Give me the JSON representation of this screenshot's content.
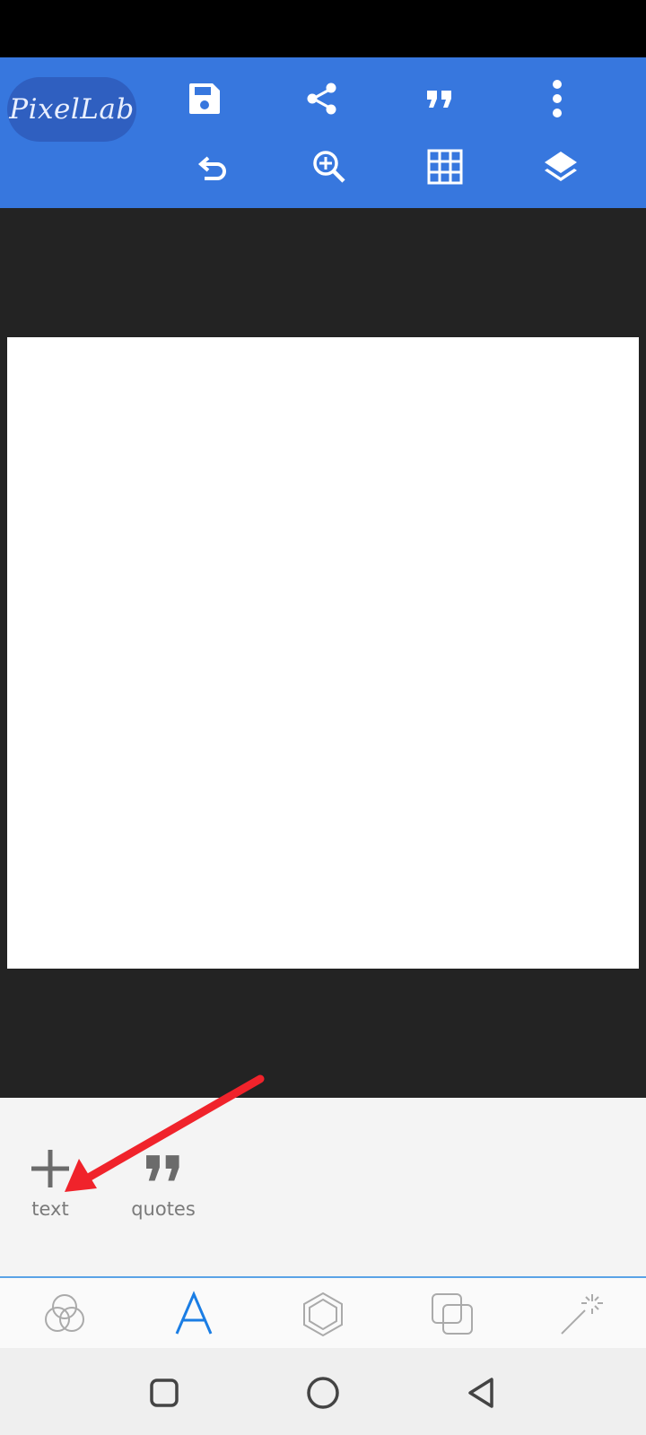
{
  "app": {
    "logo_text": "PixelLab"
  },
  "toolbar": {
    "row1": [
      "plus-icon",
      "save-icon",
      "share-icon",
      "quote-icon",
      "more-vert-icon"
    ],
    "row2": [
      "undo-icon",
      "zoom-in-icon",
      "grid-icon",
      "layers-icon"
    ]
  },
  "panel": {
    "items": [
      {
        "label": "text",
        "icon": "plus-icon"
      },
      {
        "label": "quotes",
        "icon": "quote-icon"
      }
    ]
  },
  "tabs": [
    {
      "name": "color-blend",
      "icon": "circles-icon",
      "active": false
    },
    {
      "name": "text",
      "icon": "letter-a-icon",
      "active": true
    },
    {
      "name": "shapes",
      "icon": "hexagon-icon",
      "active": false
    },
    {
      "name": "layers",
      "icon": "squares-icon",
      "active": false
    },
    {
      "name": "effects",
      "icon": "magic-wand-icon",
      "active": false
    }
  ],
  "colors": {
    "toolbar": "#3777de",
    "accent": "#1a7de4",
    "annotation_arrow": "#f0232b",
    "canvas": "#ffffff"
  }
}
